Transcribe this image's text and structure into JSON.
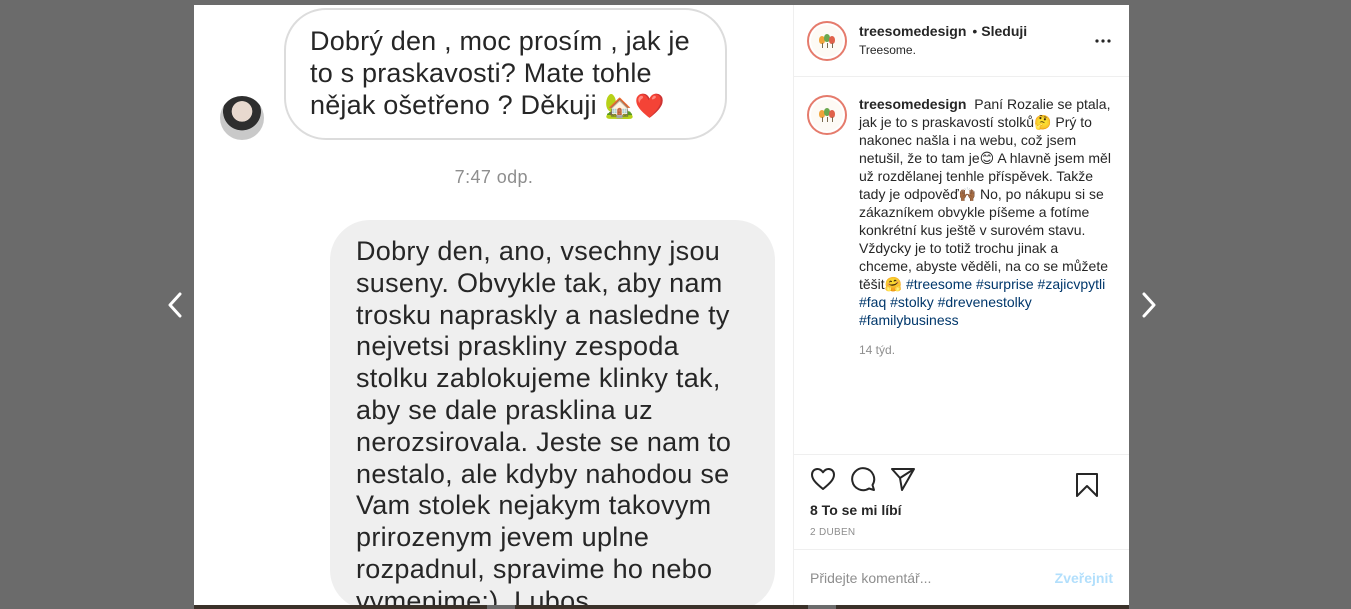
{
  "colors": {
    "backdrop": "#6b6b6b",
    "tag": "#00376b",
    "publish_disabled": "#b2dffc",
    "secondary": "#8e8e8e"
  },
  "icons": {
    "prev": "chevron-left-icon",
    "next": "chevron-right-icon",
    "more": "more-horizontal-icon",
    "like": "heart-icon",
    "comment": "comment-icon",
    "share": "share-icon",
    "save": "bookmark-icon"
  },
  "media": {
    "incoming_message": "Dobrý den , moc prosím , jak je to s praskavosti? Mate tohle nějak ošetřeno ? Děkuji",
    "incoming_emoji": "🏡❤️",
    "timestamp": "7:47 odp.",
    "outgoing_message": "Dobry den, ano, vsechny jsou suseny. Obvykle tak, aby nam trosku napraskly a nasledne ty nejvetsi praskliny zespoda stolku zablokujeme klinky tak, aby se dale prasklina uz nerozsirovala. Jeste se nam to nestalo, ale kdyby nahodou se Vam stolek nejakym takovym prirozenym jevem uplne rozpadnul, spravime ho nebo vymenime:). Lubos"
  },
  "header": {
    "username": "treesomedesign",
    "separator": "•",
    "follow_label": "Sleduji",
    "subtitle": "Treesome."
  },
  "caption": {
    "username": "treesomedesign",
    "text": "Paní Rozalie se ptala, jak je to s praskavostí stolků🤔 Prý to nakonec našla i na webu, což jsem netušil, že to tam je😊 A hlavně jsem měl už rozdělanej tenhle příspěvek. Takže tady je odpověď🙌🏾 No, po nákupu si se zákazníkem obvykle píšeme a fotíme konkrétní kus ještě v surovém stavu. Vždycky je to totiž trochu jinak a chceme, abyste věděli, na co se můžete těšit🤗",
    "hashtags": [
      "#treesome",
      "#surprise",
      "#zajicvpytli",
      "#faq",
      "#stolky",
      "#drevenestolky",
      "#familybusiness"
    ],
    "age": "14 týd."
  },
  "stats": {
    "likes": "8 To se mi líbí",
    "date": "2 DUBEN"
  },
  "comment": {
    "placeholder": "Přidejte komentář...",
    "publish_label": "Zveřejnit"
  }
}
